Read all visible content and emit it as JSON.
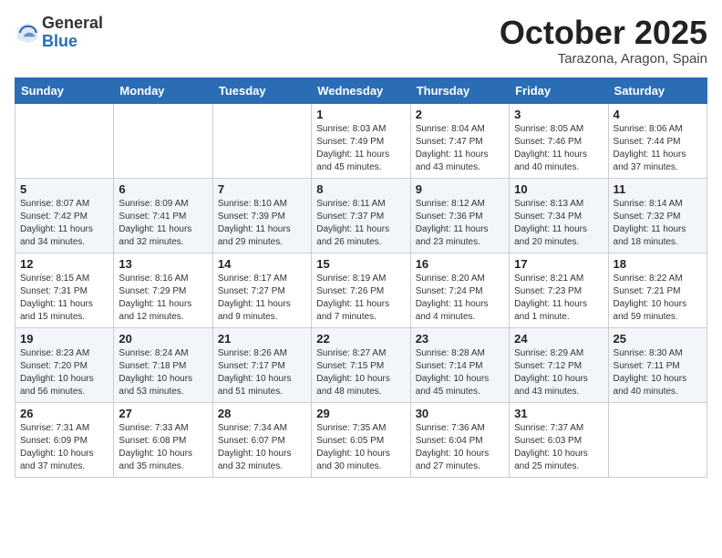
{
  "header": {
    "logo": {
      "general": "General",
      "blue": "Blue"
    },
    "title": "October 2025",
    "location": "Tarazona, Aragon, Spain"
  },
  "calendar": {
    "days_of_week": [
      "Sunday",
      "Monday",
      "Tuesday",
      "Wednesday",
      "Thursday",
      "Friday",
      "Saturday"
    ],
    "weeks": [
      [
        {
          "day": "",
          "info": ""
        },
        {
          "day": "",
          "info": ""
        },
        {
          "day": "",
          "info": ""
        },
        {
          "day": "1",
          "info": "Sunrise: 8:03 AM\nSunset: 7:49 PM\nDaylight: 11 hours and 45 minutes."
        },
        {
          "day": "2",
          "info": "Sunrise: 8:04 AM\nSunset: 7:47 PM\nDaylight: 11 hours and 43 minutes."
        },
        {
          "day": "3",
          "info": "Sunrise: 8:05 AM\nSunset: 7:46 PM\nDaylight: 11 hours and 40 minutes."
        },
        {
          "day": "4",
          "info": "Sunrise: 8:06 AM\nSunset: 7:44 PM\nDaylight: 11 hours and 37 minutes."
        }
      ],
      [
        {
          "day": "5",
          "info": "Sunrise: 8:07 AM\nSunset: 7:42 PM\nDaylight: 11 hours and 34 minutes."
        },
        {
          "day": "6",
          "info": "Sunrise: 8:09 AM\nSunset: 7:41 PM\nDaylight: 11 hours and 32 minutes."
        },
        {
          "day": "7",
          "info": "Sunrise: 8:10 AM\nSunset: 7:39 PM\nDaylight: 11 hours and 29 minutes."
        },
        {
          "day": "8",
          "info": "Sunrise: 8:11 AM\nSunset: 7:37 PM\nDaylight: 11 hours and 26 minutes."
        },
        {
          "day": "9",
          "info": "Sunrise: 8:12 AM\nSunset: 7:36 PM\nDaylight: 11 hours and 23 minutes."
        },
        {
          "day": "10",
          "info": "Sunrise: 8:13 AM\nSunset: 7:34 PM\nDaylight: 11 hours and 20 minutes."
        },
        {
          "day": "11",
          "info": "Sunrise: 8:14 AM\nSunset: 7:32 PM\nDaylight: 11 hours and 18 minutes."
        }
      ],
      [
        {
          "day": "12",
          "info": "Sunrise: 8:15 AM\nSunset: 7:31 PM\nDaylight: 11 hours and 15 minutes."
        },
        {
          "day": "13",
          "info": "Sunrise: 8:16 AM\nSunset: 7:29 PM\nDaylight: 11 hours and 12 minutes."
        },
        {
          "day": "14",
          "info": "Sunrise: 8:17 AM\nSunset: 7:27 PM\nDaylight: 11 hours and 9 minutes."
        },
        {
          "day": "15",
          "info": "Sunrise: 8:19 AM\nSunset: 7:26 PM\nDaylight: 11 hours and 7 minutes."
        },
        {
          "day": "16",
          "info": "Sunrise: 8:20 AM\nSunset: 7:24 PM\nDaylight: 11 hours and 4 minutes."
        },
        {
          "day": "17",
          "info": "Sunrise: 8:21 AM\nSunset: 7:23 PM\nDaylight: 11 hours and 1 minute."
        },
        {
          "day": "18",
          "info": "Sunrise: 8:22 AM\nSunset: 7:21 PM\nDaylight: 10 hours and 59 minutes."
        }
      ],
      [
        {
          "day": "19",
          "info": "Sunrise: 8:23 AM\nSunset: 7:20 PM\nDaylight: 10 hours and 56 minutes."
        },
        {
          "day": "20",
          "info": "Sunrise: 8:24 AM\nSunset: 7:18 PM\nDaylight: 10 hours and 53 minutes."
        },
        {
          "day": "21",
          "info": "Sunrise: 8:26 AM\nSunset: 7:17 PM\nDaylight: 10 hours and 51 minutes."
        },
        {
          "day": "22",
          "info": "Sunrise: 8:27 AM\nSunset: 7:15 PM\nDaylight: 10 hours and 48 minutes."
        },
        {
          "day": "23",
          "info": "Sunrise: 8:28 AM\nSunset: 7:14 PM\nDaylight: 10 hours and 45 minutes."
        },
        {
          "day": "24",
          "info": "Sunrise: 8:29 AM\nSunset: 7:12 PM\nDaylight: 10 hours and 43 minutes."
        },
        {
          "day": "25",
          "info": "Sunrise: 8:30 AM\nSunset: 7:11 PM\nDaylight: 10 hours and 40 minutes."
        }
      ],
      [
        {
          "day": "26",
          "info": "Sunrise: 7:31 AM\nSunset: 6:09 PM\nDaylight: 10 hours and 37 minutes."
        },
        {
          "day": "27",
          "info": "Sunrise: 7:33 AM\nSunset: 6:08 PM\nDaylight: 10 hours and 35 minutes."
        },
        {
          "day": "28",
          "info": "Sunrise: 7:34 AM\nSunset: 6:07 PM\nDaylight: 10 hours and 32 minutes."
        },
        {
          "day": "29",
          "info": "Sunrise: 7:35 AM\nSunset: 6:05 PM\nDaylight: 10 hours and 30 minutes."
        },
        {
          "day": "30",
          "info": "Sunrise: 7:36 AM\nSunset: 6:04 PM\nDaylight: 10 hours and 27 minutes."
        },
        {
          "day": "31",
          "info": "Sunrise: 7:37 AM\nSunset: 6:03 PM\nDaylight: 10 hours and 25 minutes."
        },
        {
          "day": "",
          "info": ""
        }
      ]
    ]
  }
}
